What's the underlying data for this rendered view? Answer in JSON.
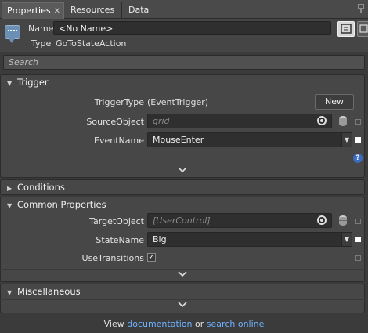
{
  "tabs": [
    {
      "label": "Properties",
      "close": "✕"
    },
    {
      "label": "Resources"
    },
    {
      "label": "Data"
    }
  ],
  "header": {
    "name_label": "Name",
    "name_value": "<No Name>",
    "type_label": "Type",
    "type_value": "GoToStateAction"
  },
  "search": {
    "placeholder": "Search"
  },
  "trigger": {
    "title": "Trigger",
    "trigger_type_label": "TriggerType",
    "trigger_type_value": "(EventTrigger)",
    "new_button": "New",
    "source_object_label": "SourceObject",
    "source_object_hint": "grid",
    "event_name_label": "EventName",
    "event_name_value": "MouseEnter",
    "help_glyph": "?"
  },
  "conditions": {
    "title": "Conditions"
  },
  "common": {
    "title": "Common Properties",
    "target_object_label": "TargetObject",
    "target_object_hint": "[UserControl]",
    "state_name_label": "StateName",
    "state_name_value": "Big",
    "use_transitions_label": "UseTransitions",
    "use_transitions_checked": "✓"
  },
  "misc": {
    "title": "Miscellaneous"
  },
  "footer": {
    "prefix": "View",
    "link1": "documentation",
    "middle": "or",
    "link2": "search online"
  },
  "icons": {
    "pin": "pin-icon",
    "action": "action-icon",
    "target": "target-picker-icon",
    "database": "data-binding-icon",
    "dropdown": "chevron-down-icon",
    "expand": "expand-chevron-icon"
  },
  "colors": {
    "link": "#6fb1ff",
    "help": "#3c6cc0"
  }
}
